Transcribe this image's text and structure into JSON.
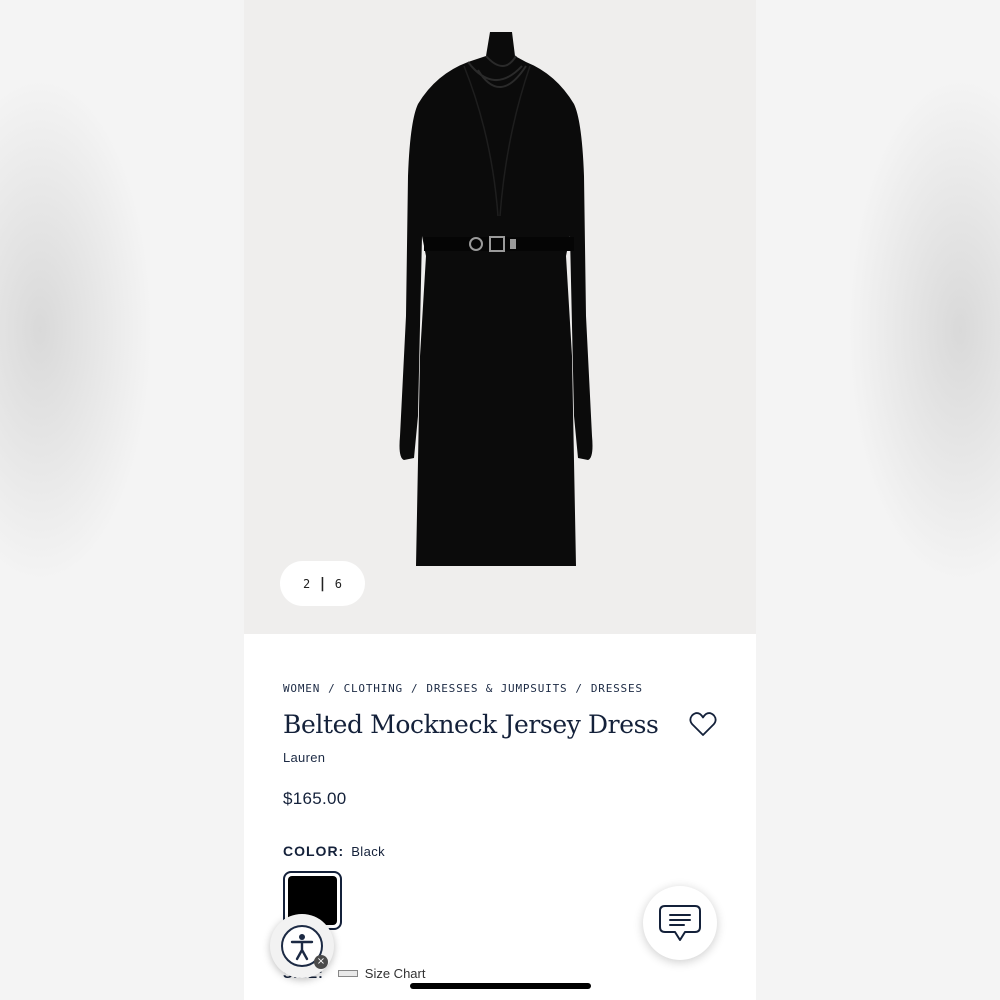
{
  "gallery": {
    "current": "2",
    "separator": "|",
    "total": "6",
    "image": "black-belted-dress"
  },
  "breadcrumb": [
    "WOMEN",
    "CLOTHING",
    "DRESSES & JUMPSUITS",
    "DRESSES"
  ],
  "breadcrumb_separator": "/",
  "product": {
    "title": "Belted Mockneck Jersey Dress",
    "brand": "Lauren",
    "price": "$165.00",
    "favorite_icon": "heart-outline-icon"
  },
  "color": {
    "label": "COLOR:",
    "value": "Black",
    "swatch_hex": "#000000"
  },
  "size": {
    "label": "SIZE:",
    "chart_label": "Size Chart",
    "chart_icon": "ruler-icon"
  },
  "floating": {
    "accessibility_icon": "accessibility-person-icon",
    "close_glyph": "×",
    "chat_icon": "chat-bubble-icon"
  },
  "colors": {
    "navy_text": "#14213a",
    "hero_bg": "#efeeed"
  }
}
